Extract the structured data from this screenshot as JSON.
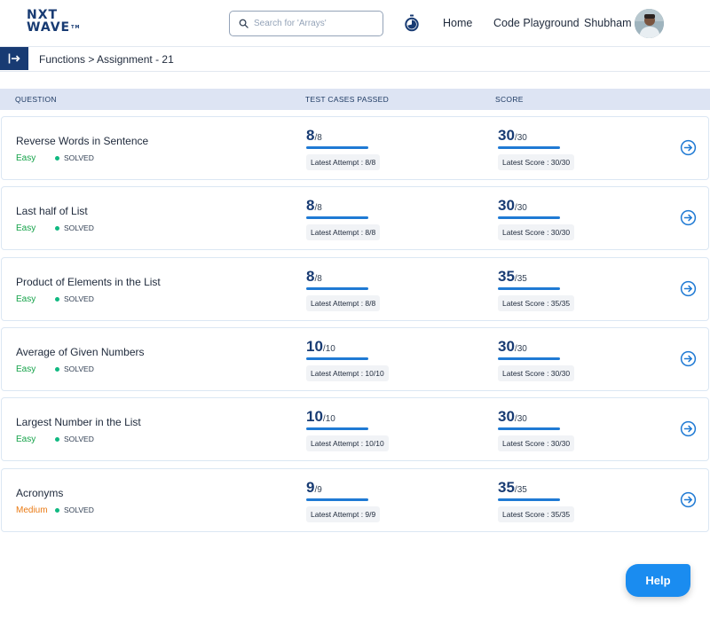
{
  "header": {
    "logo_line1": "NXT",
    "logo_line2": "WAVE",
    "logo_tm": "TM",
    "search_placeholder": "Search for 'Arrays'",
    "nav_home": "Home",
    "nav_playground": "Code Playground",
    "user_name": "Shubham"
  },
  "breadcrumb": "Functions > Assignment - 21",
  "table": {
    "columns": [
      "QUESTION",
      "TEST CASES PASSED",
      "SCORE"
    ],
    "rows": [
      {
        "title": "Reverse Words in Sentence",
        "difficulty": "Easy",
        "status": "SOLVED",
        "passed": "8",
        "total": "/8",
        "attempt": "Latest Attempt : 8/8",
        "score": "30",
        "max": "/30",
        "latest_score": "Latest Score : 30/30"
      },
      {
        "title": "Last half of List",
        "difficulty": "Easy",
        "status": "SOLVED",
        "passed": "8",
        "total": "/8",
        "attempt": "Latest Attempt : 8/8",
        "score": "30",
        "max": "/30",
        "latest_score": "Latest Score : 30/30"
      },
      {
        "title": "Product of Elements in the List",
        "difficulty": "Easy",
        "status": "SOLVED",
        "passed": "8",
        "total": "/8",
        "attempt": "Latest Attempt : 8/8",
        "score": "35",
        "max": "/35",
        "latest_score": "Latest Score : 35/35"
      },
      {
        "title": "Average of Given Numbers",
        "difficulty": "Easy",
        "status": "SOLVED",
        "passed": "10",
        "total": "/10",
        "attempt": "Latest Attempt : 10/10",
        "score": "30",
        "max": "/30",
        "latest_score": "Latest Score : 30/30"
      },
      {
        "title": "Largest Number in the List",
        "difficulty": "Easy",
        "status": "SOLVED",
        "passed": "10",
        "total": "/10",
        "attempt": "Latest Attempt : 10/10",
        "score": "30",
        "max": "/30",
        "latest_score": "Latest Score : 30/30"
      },
      {
        "title": "Acronyms",
        "difficulty": "Medium",
        "status": "SOLVED",
        "passed": "9",
        "total": "/9",
        "attempt": "Latest Attempt : 9/9",
        "score": "35",
        "max": "/35",
        "latest_score": "Latest Score : 35/35"
      }
    ]
  },
  "help_label": "Help",
  "colors": {
    "brand_navy": "#183b73",
    "accent_blue": "#1a8cf0",
    "easy_green": "#16a34a",
    "medium_orange": "#ea7a14",
    "solved_dot": "#10b981"
  }
}
